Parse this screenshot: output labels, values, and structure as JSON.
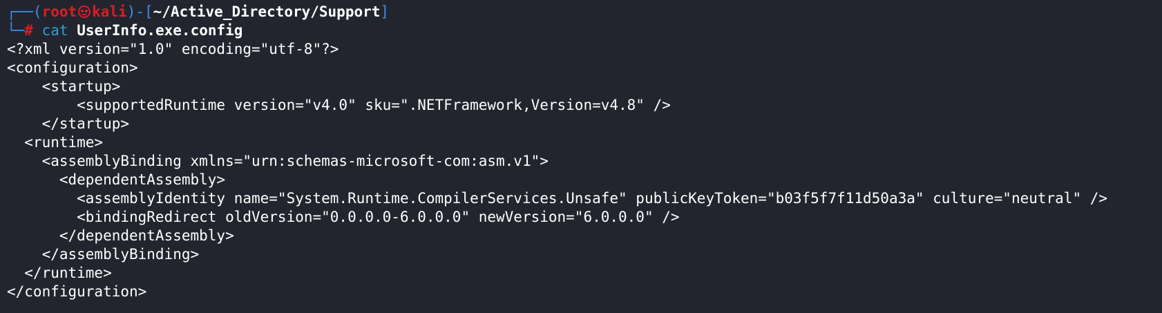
{
  "prompt": {
    "box_top_left": "┌──(",
    "user": "root",
    "host": "kali",
    "sep_open": ")-[",
    "path": "~/Active_Directory/Support",
    "sep_close": "]",
    "box_bottom_left": "└─",
    "hash": "#",
    "command": "cat",
    "argument": "UserInfo.exe.config"
  },
  "output_lines": [
    "<?xml version=\"1.0\" encoding=\"utf-8\"?>",
    "<configuration>",
    "    <startup>",
    "        <supportedRuntime version=\"v4.0\" sku=\".NETFramework,Version=v4.8\" />",
    "    </startup>",
    "  <runtime>",
    "    <assemblyBinding xmlns=\"urn:schemas-microsoft-com:asm.v1\">",
    "      <dependentAssembly>",
    "        <assemblyIdentity name=\"System.Runtime.CompilerServices.Unsafe\" publicKeyToken=\"b03f5f7f11d50a3a\" culture=\"neutral\" />",
    "        <bindingRedirect oldVersion=\"0.0.0.0-6.0.0.0\" newVersion=\"6.0.0.0\" />",
    "      </dependentAssembly>",
    "    </assemblyBinding>",
    "  </runtime>",
    "</configuration>"
  ],
  "colors": {
    "background": "#23252e",
    "prompt_frame": "#3b8eea",
    "user_host": "#e01b24",
    "command": "#2e9fd8",
    "text": "#ffffff"
  },
  "icons": {
    "user_host_separator": "skull-icon"
  }
}
